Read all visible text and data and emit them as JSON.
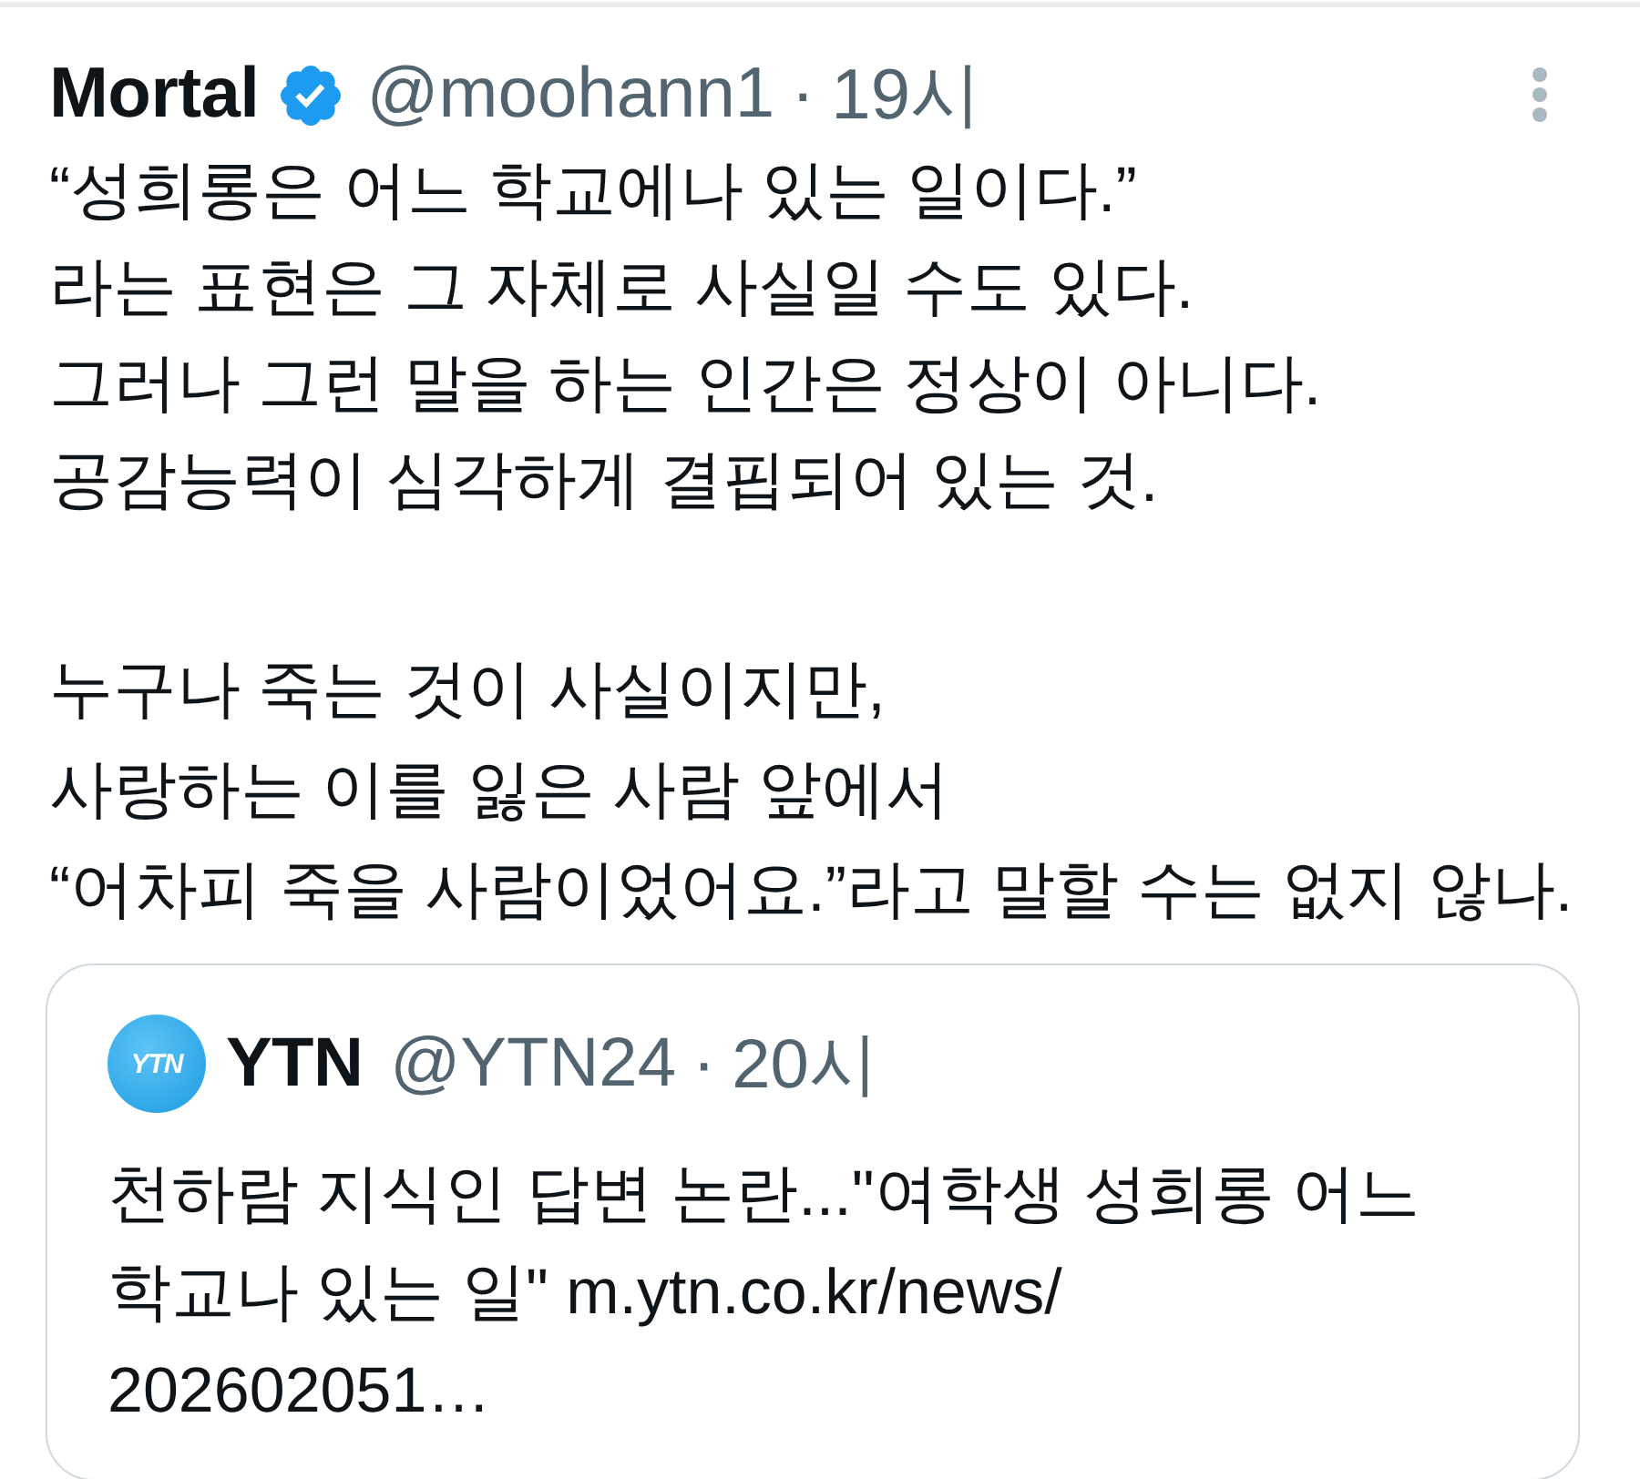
{
  "tweet": {
    "author": {
      "name": "Mortal",
      "verified": true,
      "handle": "@moohann1",
      "separator": "·",
      "time": "19시"
    },
    "paragraphs": [
      "“성희롱은 어느 학교에나 있는 일이다.”\n라는 표현은 그 자체로 사실일 수도 있다.\n그러나 그런 말을 하는 인간은 정상이 아니다.\n공감능력이 심각하게 결핍되어 있는 것.",
      "누구나 죽는 것이 사실이지만,\n사랑하는 이를 잃은 사람 앞에서\n“어차피 죽을 사람이었어요.”라고 말할 수는 없지 않나."
    ],
    "quote": {
      "author": {
        "logo_text": "YTN",
        "name": "YTN",
        "handle": "@YTN24",
        "separator": "·",
        "time": "20시"
      },
      "text": "천하람 지식인 답변 논란...\"여학생 성희롱 어느\n학교나 있는 일\" m.ytn.co.kr/news/\n202602051…"
    }
  }
}
